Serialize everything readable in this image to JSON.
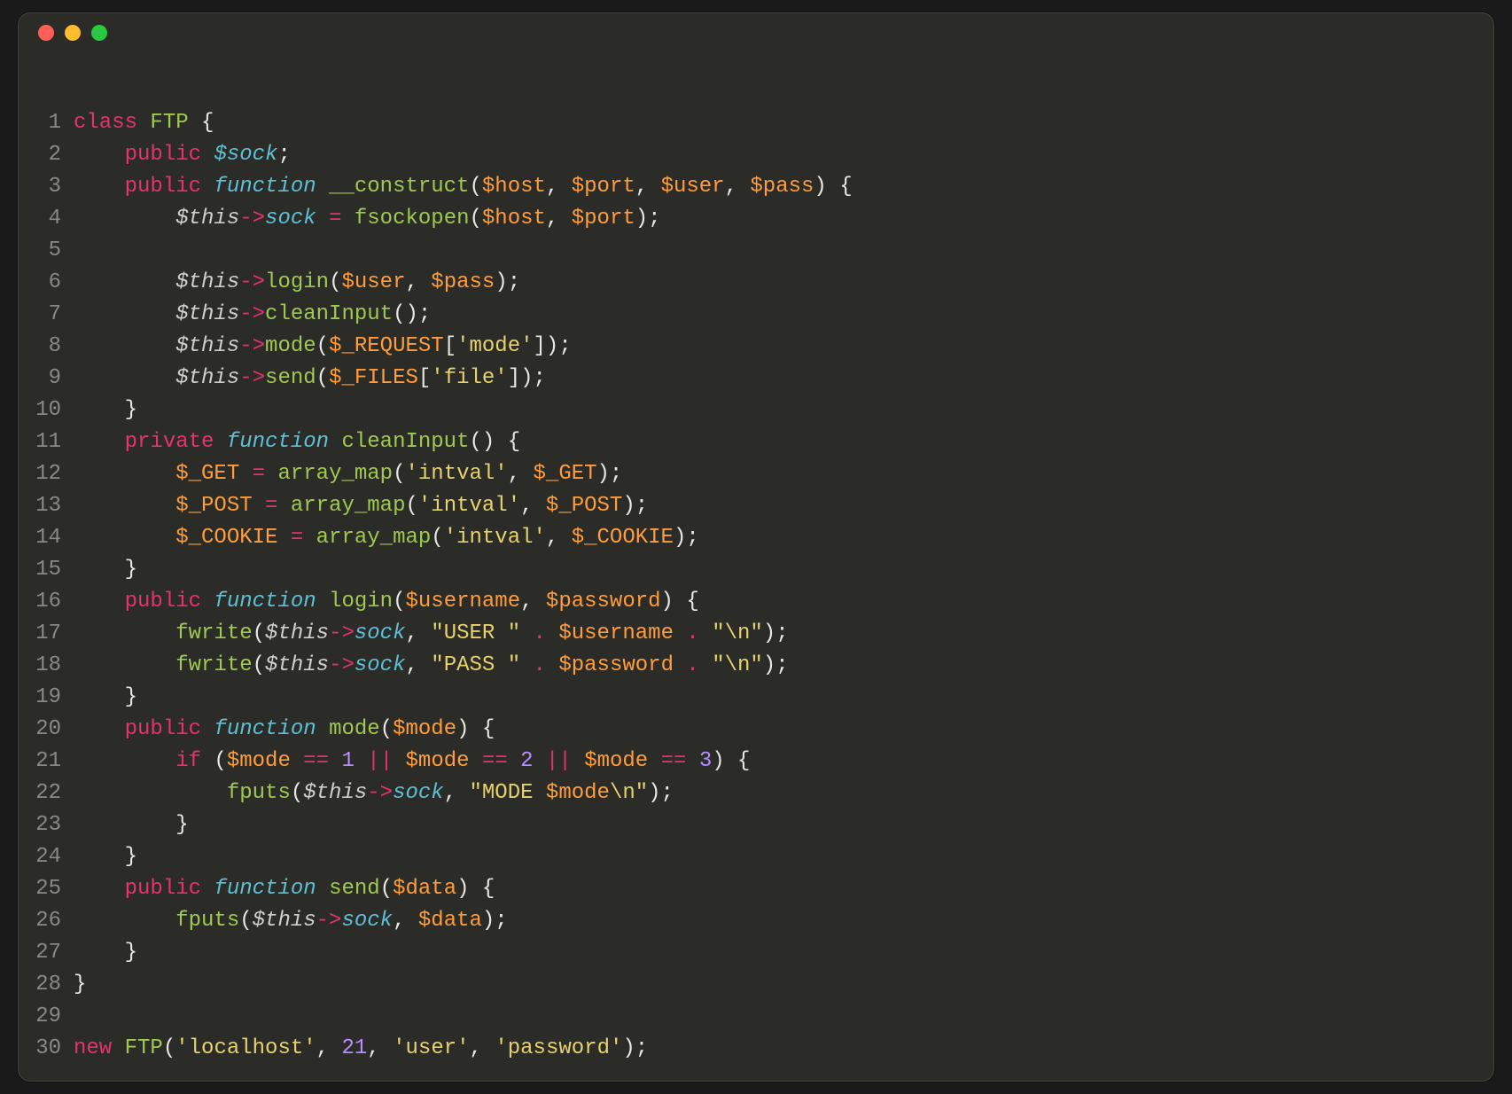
{
  "window": {
    "traffic_lights": [
      "close",
      "minimize",
      "zoom"
    ]
  },
  "code": {
    "lines": [
      {
        "n": 1,
        "t": [
          [
            "k",
            "class "
          ],
          [
            "fn",
            "FTP"
          ],
          [
            "p",
            " {"
          ]
        ]
      },
      {
        "n": 2,
        "t": [
          [
            "p",
            "    "
          ],
          [
            "k",
            "public "
          ],
          [
            "kw2",
            "$sock"
          ],
          [
            "p",
            ";"
          ]
        ]
      },
      {
        "n": 3,
        "t": [
          [
            "p",
            "    "
          ],
          [
            "k",
            "public "
          ],
          [
            "kw2",
            "function "
          ],
          [
            "fn",
            "__construct"
          ],
          [
            "p",
            "("
          ],
          [
            "sup",
            "$host"
          ],
          [
            "p",
            ", "
          ],
          [
            "sup",
            "$port"
          ],
          [
            "p",
            ", "
          ],
          [
            "sup",
            "$user"
          ],
          [
            "p",
            ", "
          ],
          [
            "sup",
            "$pass"
          ],
          [
            "p",
            ") {"
          ]
        ]
      },
      {
        "n": 4,
        "t": [
          [
            "p",
            "        "
          ],
          [
            "this",
            "$this"
          ],
          [
            "op",
            "->"
          ],
          [
            "kw2",
            "sock"
          ],
          [
            "p",
            " "
          ],
          [
            "op",
            "="
          ],
          [
            "p",
            " "
          ],
          [
            "fn",
            "fsockopen"
          ],
          [
            "p",
            "("
          ],
          [
            "sup",
            "$host"
          ],
          [
            "p",
            ", "
          ],
          [
            "sup",
            "$port"
          ],
          [
            "p",
            ");"
          ]
        ]
      },
      {
        "n": 5,
        "t": [
          [
            "p",
            ""
          ]
        ]
      },
      {
        "n": 6,
        "t": [
          [
            "p",
            "        "
          ],
          [
            "this",
            "$this"
          ],
          [
            "op",
            "->"
          ],
          [
            "fn",
            "login"
          ],
          [
            "p",
            "("
          ],
          [
            "sup",
            "$user"
          ],
          [
            "p",
            ", "
          ],
          [
            "sup",
            "$pass"
          ],
          [
            "p",
            ");"
          ]
        ]
      },
      {
        "n": 7,
        "t": [
          [
            "p",
            "        "
          ],
          [
            "this",
            "$this"
          ],
          [
            "op",
            "->"
          ],
          [
            "fn",
            "cleanInput"
          ],
          [
            "p",
            "();"
          ]
        ]
      },
      {
        "n": 8,
        "t": [
          [
            "p",
            "        "
          ],
          [
            "this",
            "$this"
          ],
          [
            "op",
            "->"
          ],
          [
            "fn",
            "mode"
          ],
          [
            "p",
            "("
          ],
          [
            "sup",
            "$_REQUEST"
          ],
          [
            "p",
            "["
          ],
          [
            "str",
            "'mode'"
          ],
          [
            "p",
            "]);"
          ]
        ]
      },
      {
        "n": 9,
        "t": [
          [
            "p",
            "        "
          ],
          [
            "this",
            "$this"
          ],
          [
            "op",
            "->"
          ],
          [
            "fn",
            "send"
          ],
          [
            "p",
            "("
          ],
          [
            "sup",
            "$_FILES"
          ],
          [
            "p",
            "["
          ],
          [
            "str",
            "'file'"
          ],
          [
            "p",
            "]);"
          ]
        ]
      },
      {
        "n": 10,
        "t": [
          [
            "p",
            "    }"
          ]
        ]
      },
      {
        "n": 11,
        "t": [
          [
            "p",
            "    "
          ],
          [
            "k",
            "private "
          ],
          [
            "kw2",
            "function "
          ],
          [
            "fn",
            "cleanInput"
          ],
          [
            "p",
            "() {"
          ]
        ]
      },
      {
        "n": 12,
        "t": [
          [
            "p",
            "        "
          ],
          [
            "sup",
            "$_GET"
          ],
          [
            "p",
            " "
          ],
          [
            "op",
            "="
          ],
          [
            "p",
            " "
          ],
          [
            "fn",
            "array_map"
          ],
          [
            "p",
            "("
          ],
          [
            "str",
            "'intval'"
          ],
          [
            "p",
            ", "
          ],
          [
            "sup",
            "$_GET"
          ],
          [
            "p",
            ");"
          ]
        ]
      },
      {
        "n": 13,
        "t": [
          [
            "p",
            "        "
          ],
          [
            "sup",
            "$_POST"
          ],
          [
            "p",
            " "
          ],
          [
            "op",
            "="
          ],
          [
            "p",
            " "
          ],
          [
            "fn",
            "array_map"
          ],
          [
            "p",
            "("
          ],
          [
            "str",
            "'intval'"
          ],
          [
            "p",
            ", "
          ],
          [
            "sup",
            "$_POST"
          ],
          [
            "p",
            ");"
          ]
        ]
      },
      {
        "n": 14,
        "t": [
          [
            "p",
            "        "
          ],
          [
            "sup",
            "$_COOKIE"
          ],
          [
            "p",
            " "
          ],
          [
            "op",
            "="
          ],
          [
            "p",
            " "
          ],
          [
            "fn",
            "array_map"
          ],
          [
            "p",
            "("
          ],
          [
            "str",
            "'intval'"
          ],
          [
            "p",
            ", "
          ],
          [
            "sup",
            "$_COOKIE"
          ],
          [
            "p",
            ");"
          ]
        ]
      },
      {
        "n": 15,
        "t": [
          [
            "p",
            "    }"
          ]
        ]
      },
      {
        "n": 16,
        "t": [
          [
            "p",
            "    "
          ],
          [
            "k",
            "public "
          ],
          [
            "kw2",
            "function "
          ],
          [
            "fn",
            "login"
          ],
          [
            "p",
            "("
          ],
          [
            "sup",
            "$username"
          ],
          [
            "p",
            ", "
          ],
          [
            "sup",
            "$password"
          ],
          [
            "p",
            ") {"
          ]
        ]
      },
      {
        "n": 17,
        "t": [
          [
            "p",
            "        "
          ],
          [
            "fn",
            "fwrite"
          ],
          [
            "p",
            "("
          ],
          [
            "this",
            "$this"
          ],
          [
            "op",
            "->"
          ],
          [
            "kw2",
            "sock"
          ],
          [
            "p",
            ", "
          ],
          [
            "str",
            "\"USER \""
          ],
          [
            "p",
            " "
          ],
          [
            "op",
            "."
          ],
          [
            "p",
            " "
          ],
          [
            "sup",
            "$username"
          ],
          [
            "p",
            " "
          ],
          [
            "op",
            "."
          ],
          [
            "p",
            " "
          ],
          [
            "str",
            "\"\\n\""
          ],
          [
            "p",
            ");"
          ]
        ]
      },
      {
        "n": 18,
        "t": [
          [
            "p",
            "        "
          ],
          [
            "fn",
            "fwrite"
          ],
          [
            "p",
            "("
          ],
          [
            "this",
            "$this"
          ],
          [
            "op",
            "->"
          ],
          [
            "kw2",
            "sock"
          ],
          [
            "p",
            ", "
          ],
          [
            "str",
            "\"PASS \""
          ],
          [
            "p",
            " "
          ],
          [
            "op",
            "."
          ],
          [
            "p",
            " "
          ],
          [
            "sup",
            "$password"
          ],
          [
            "p",
            " "
          ],
          [
            "op",
            "."
          ],
          [
            "p",
            " "
          ],
          [
            "str",
            "\"\\n\""
          ],
          [
            "p",
            ");"
          ]
        ]
      },
      {
        "n": 19,
        "t": [
          [
            "p",
            "    }"
          ]
        ]
      },
      {
        "n": 20,
        "t": [
          [
            "p",
            "    "
          ],
          [
            "k",
            "public "
          ],
          [
            "kw2",
            "function "
          ],
          [
            "fn",
            "mode"
          ],
          [
            "p",
            "("
          ],
          [
            "sup",
            "$mode"
          ],
          [
            "p",
            ") {"
          ]
        ]
      },
      {
        "n": 21,
        "t": [
          [
            "p",
            "        "
          ],
          [
            "k",
            "if"
          ],
          [
            "p",
            " ("
          ],
          [
            "sup",
            "$mode"
          ],
          [
            "p",
            " "
          ],
          [
            "op",
            "=="
          ],
          [
            "p",
            " "
          ],
          [
            "num",
            "1"
          ],
          [
            "p",
            " "
          ],
          [
            "op",
            "||"
          ],
          [
            "p",
            " "
          ],
          [
            "sup",
            "$mode"
          ],
          [
            "p",
            " "
          ],
          [
            "op",
            "=="
          ],
          [
            "p",
            " "
          ],
          [
            "num",
            "2"
          ],
          [
            "p",
            " "
          ],
          [
            "op",
            "||"
          ],
          [
            "p",
            " "
          ],
          [
            "sup",
            "$mode"
          ],
          [
            "p",
            " "
          ],
          [
            "op",
            "=="
          ],
          [
            "p",
            " "
          ],
          [
            "num",
            "3"
          ],
          [
            "p",
            ") {"
          ]
        ]
      },
      {
        "n": 22,
        "t": [
          [
            "p",
            "            "
          ],
          [
            "fn",
            "fputs"
          ],
          [
            "p",
            "("
          ],
          [
            "this",
            "$this"
          ],
          [
            "op",
            "->"
          ],
          [
            "kw2",
            "sock"
          ],
          [
            "p",
            ", "
          ],
          [
            "str",
            "\"MODE "
          ],
          [
            "sup",
            "$mode"
          ],
          [
            "str",
            "\\n\""
          ],
          [
            "p",
            ");"
          ]
        ]
      },
      {
        "n": 23,
        "t": [
          [
            "p",
            "        }"
          ]
        ]
      },
      {
        "n": 24,
        "t": [
          [
            "p",
            "    }"
          ]
        ]
      },
      {
        "n": 25,
        "t": [
          [
            "p",
            "    "
          ],
          [
            "k",
            "public "
          ],
          [
            "kw2",
            "function "
          ],
          [
            "fn",
            "send"
          ],
          [
            "p",
            "("
          ],
          [
            "sup",
            "$data"
          ],
          [
            "p",
            ") {"
          ]
        ]
      },
      {
        "n": 26,
        "t": [
          [
            "p",
            "        "
          ],
          [
            "fn",
            "fputs"
          ],
          [
            "p",
            "("
          ],
          [
            "this",
            "$this"
          ],
          [
            "op",
            "->"
          ],
          [
            "kw2",
            "sock"
          ],
          [
            "p",
            ", "
          ],
          [
            "sup",
            "$data"
          ],
          [
            "p",
            ");"
          ]
        ]
      },
      {
        "n": 27,
        "t": [
          [
            "p",
            "    }"
          ]
        ]
      },
      {
        "n": 28,
        "t": [
          [
            "p",
            "}"
          ]
        ]
      },
      {
        "n": 29,
        "t": [
          [
            "p",
            ""
          ]
        ]
      },
      {
        "n": 30,
        "t": [
          [
            "k",
            "new "
          ],
          [
            "fn",
            "FTP"
          ],
          [
            "p",
            "("
          ],
          [
            "str",
            "'localhost'"
          ],
          [
            "p",
            ", "
          ],
          [
            "num",
            "21"
          ],
          [
            "p",
            ", "
          ],
          [
            "str",
            "'user'"
          ],
          [
            "p",
            ", "
          ],
          [
            "str",
            "'password'"
          ],
          [
            "p",
            ");"
          ]
        ]
      }
    ]
  }
}
